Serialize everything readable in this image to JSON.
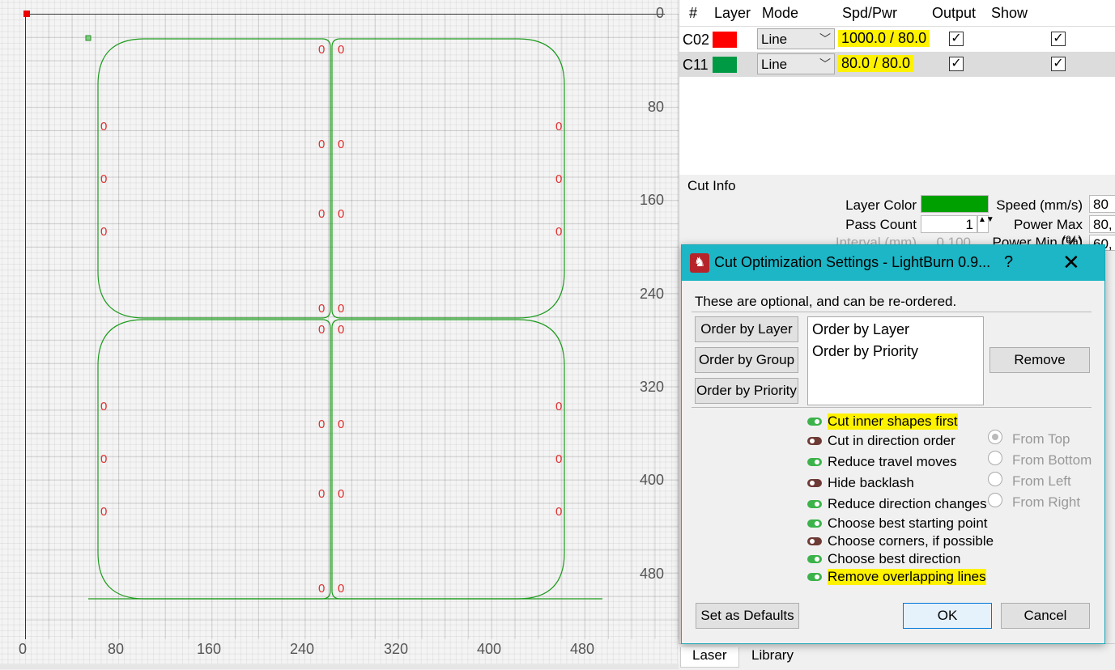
{
  "canvas": {
    "y_ticks": [
      "0",
      "80",
      "160",
      "240",
      "320",
      "400",
      "480"
    ],
    "x_ticks": [
      "0",
      "80",
      "160",
      "240",
      "320",
      "400",
      "480"
    ],
    "marker_label": "0"
  },
  "layers": {
    "headers": {
      "num": "#",
      "layer": "Layer",
      "mode": "Mode",
      "spd": "Spd/Pwr",
      "output": "Output",
      "show": "Show"
    },
    "rows": [
      {
        "num": "C02",
        "color": "#ff0000",
        "mode": "Line",
        "spd": "1000.0 / 80.0",
        "output": "✓",
        "show": "✓"
      },
      {
        "num": "C11",
        "color": "#009a44",
        "mode": "Line",
        "spd": "80.0 / 80.0",
        "output": "✓",
        "show": "✓"
      }
    ]
  },
  "cut_info": {
    "title": "Cut Info",
    "layer_color_label": "Layer Color",
    "layer_color": "#00a000",
    "pass_count_label": "Pass Count",
    "pass_count": "1",
    "interval_label": "Interval (mm)",
    "interval": "0.100",
    "speed_label": "Speed (mm/s)",
    "speed": "80",
    "power_max_label": "Power Max (%)",
    "power_max": "80,",
    "power_min_label": "Power Min (%)",
    "power_min": "60,"
  },
  "bottom_tabs": {
    "laser": "Laser",
    "library": "Library"
  },
  "dialog": {
    "title": "Cut Optimization Settings - LightBurn 0.9...",
    "help": "?",
    "close": "✕",
    "intro": "These are optional, and can be re-ordered.",
    "buttons": {
      "order_by_layer": "Order by Layer",
      "order_by_group": "Order by Group",
      "order_by_priority": "Order by Priority",
      "remove": "Remove",
      "set_defaults": "Set as Defaults",
      "ok": "OK",
      "cancel": "Cancel"
    },
    "order_list": [
      "Order by Layer",
      "Order by Priority"
    ],
    "options": [
      {
        "label": "Cut inner shapes first",
        "on": true
      },
      {
        "label": "Cut in direction order",
        "on": false
      },
      {
        "label": "Reduce travel moves",
        "on": true
      },
      {
        "label": "Hide backlash",
        "on": false
      },
      {
        "label": "Reduce direction changes",
        "on": true
      },
      {
        "label": "Choose best starting point",
        "on": true
      },
      {
        "label": "Choose corners, if possible",
        "on": false
      },
      {
        "label": "Choose best direction",
        "on": true
      },
      {
        "label": "Remove overlapping lines",
        "on": true
      }
    ],
    "direction": [
      "From Top",
      "From Bottom",
      "From Left",
      "From Right"
    ],
    "colors": {
      "title_bar": "#1cb6c6",
      "highlight": "#fff200",
      "toggle_on": "#3bb34a",
      "toggle_off": "#6e3a35"
    }
  }
}
